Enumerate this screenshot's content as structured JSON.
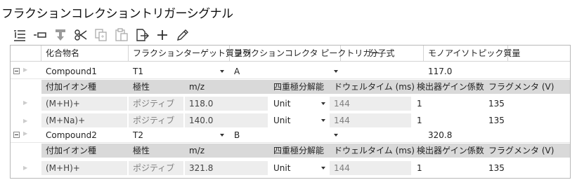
{
  "title": "フラクションコレクショントリガーシグナル",
  "toolbar": {
    "icons": [
      "list-icon",
      "collapse-icon",
      "save-down-icon",
      "cut-icon",
      "copy-icon",
      "paste-icon",
      "export-icon",
      "add-icon",
      "edit-icon"
    ]
  },
  "grid": {
    "columns": [
      "化合物名",
      "フラクションターゲット質量列",
      "フラクションコレクタ ピークトリガー",
      "分子式",
      "モノアイソトピック質量"
    ],
    "child_columns": [
      "付加イオン種",
      "極性",
      "m/z",
      "四重極分解能",
      "ドウェルタイム (ms)",
      "検出器ゲイン係数",
      "フラグメンタ (V)"
    ],
    "compounds": [
      {
        "name": "Compound1",
        "target": "T1",
        "trigger": "A",
        "formula": "",
        "mono_mass": "117.0",
        "adducts": [
          {
            "ion": "(M+H)+",
            "polarity": "ポジティブ",
            "mz": "118.0",
            "resolution": "Unit",
            "dwell": "144",
            "gain": "1",
            "fragmentor": "135"
          },
          {
            "ion": "(M+Na)+",
            "polarity": "ポジティブ",
            "mz": "140.0",
            "resolution": "Unit",
            "dwell": "144",
            "gain": "1",
            "fragmentor": "135"
          }
        ]
      },
      {
        "name": "Compound2",
        "target": "T2",
        "trigger": "B",
        "formula": "",
        "mono_mass": "320.8",
        "adducts": [
          {
            "ion": "(M+H)+",
            "polarity": "ポジティブ",
            "mz": "321.8",
            "resolution": "Unit",
            "dwell": "144",
            "gain": "1",
            "fragmentor": "135"
          }
        ]
      }
    ]
  }
}
